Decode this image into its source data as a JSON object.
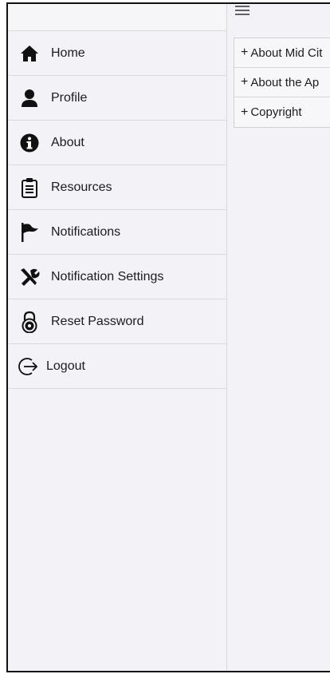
{
  "sidebar": {
    "items": [
      {
        "label": "Home",
        "icon": "home-icon"
      },
      {
        "label": "Profile",
        "icon": "user-icon"
      },
      {
        "label": "About",
        "icon": "info-icon"
      },
      {
        "label": "Resources",
        "icon": "clipboard-icon"
      },
      {
        "label": "Notifications",
        "icon": "flag-icon"
      },
      {
        "label": "Notification Settings",
        "icon": "tools-icon"
      },
      {
        "label": "Reset Password",
        "icon": "lock-icon"
      },
      {
        "label": "Logout",
        "icon": "logout-icon"
      }
    ]
  },
  "main": {
    "menu_icon": "hamburger-icon",
    "accordion": [
      {
        "prefix": "+",
        "label": "About Mid Cit"
      },
      {
        "prefix": "+",
        "label": "About the Ap"
      },
      {
        "prefix": "+",
        "label": "Copyright"
      }
    ]
  },
  "colors": {
    "background": "#f2f2f7",
    "text": "#1c1c1e",
    "divider": "#dcdce0"
  }
}
